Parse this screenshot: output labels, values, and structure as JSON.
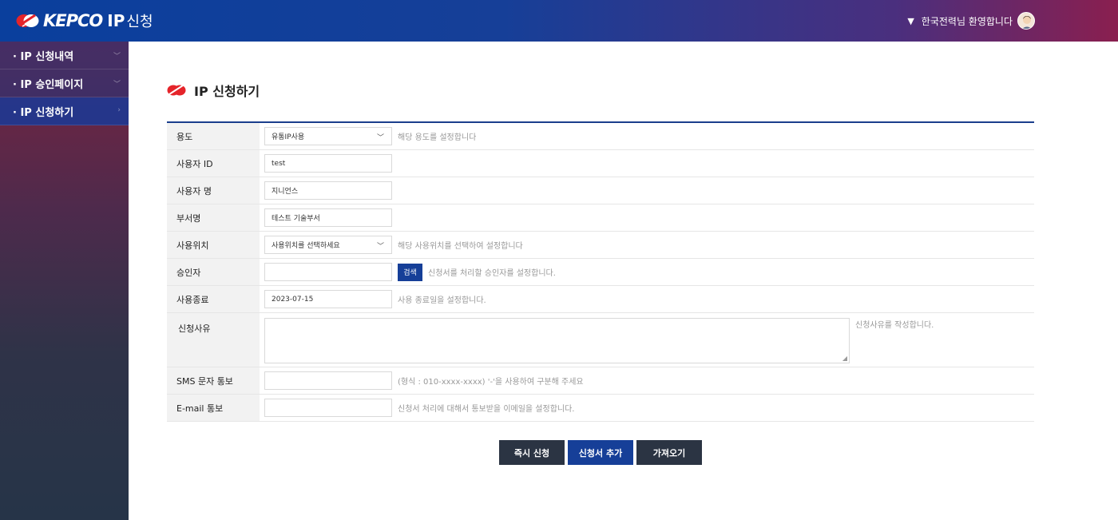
{
  "header": {
    "logo_text": "KEPCO",
    "logo_sub": "IP",
    "logo_sub2": "신청",
    "welcome": "한국전력님 환영합니다"
  },
  "sidebar": {
    "items": [
      {
        "label": "· IP 신청내역"
      },
      {
        "label": "· IP 승인페이지"
      },
      {
        "label": "· IP 신청하기"
      }
    ]
  },
  "page": {
    "title": "IP 신청하기"
  },
  "form": {
    "rows": [
      {
        "label": "용도",
        "value": "유통IP사용",
        "hint": "해당 용도를 설정합니다"
      },
      {
        "label": "사용자 ID",
        "value": "test"
      },
      {
        "label": "사용자 명",
        "value": "지니언스"
      },
      {
        "label": "부서명",
        "value": "테스트 기술부서"
      },
      {
        "label": "사용위치",
        "value": "사용위치를 선택하세요",
        "hint": "해당 사용위치를 선택하여 설정합니다"
      },
      {
        "label": "승인자",
        "value": "",
        "button": "검색",
        "hint": "신청서를 처리할 승인자를 설정합니다."
      },
      {
        "label": "사용종료",
        "value": "2023-07-15",
        "hint": "사용 종료일을 설정합니다."
      },
      {
        "label": "신청사유",
        "value": "",
        "hint": "신청사유를 작성합니다."
      },
      {
        "label": "SMS 문자 통보",
        "value": "",
        "hint": "(형식 : 010-xxxx-xxxx) '-'을 사용하여 구분해 주세요"
      },
      {
        "label": "E-mail 통보",
        "value": "",
        "hint": "신청서 처리에 대해서 통보받을 이메일을 설정합니다."
      }
    ]
  },
  "actions": {
    "submit_now": "즉시 신청",
    "add_form": "신청서 추가",
    "import": "가져오기"
  },
  "colors": {
    "primary": "#163f98",
    "dark": "#2b3443",
    "accent_red": "#e5242a"
  }
}
